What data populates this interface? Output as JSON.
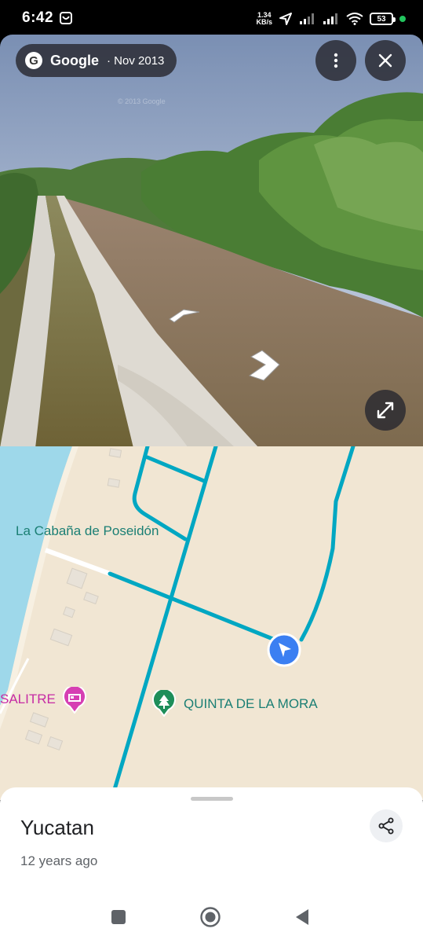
{
  "status_bar": {
    "time": "6:42",
    "net_speed_value": "1.34",
    "net_speed_unit": "KB/s",
    "battery": "53"
  },
  "street_view": {
    "brand": "Google",
    "date": "· Nov 2013",
    "watermark": "© 2013 Google"
  },
  "map": {
    "labels": {
      "cabana": "La Cabaña de Poseidón",
      "salitre": "SALITRE",
      "quinta": "QUINTA DE LA MORA"
    }
  },
  "sheet": {
    "title": "Yucatan",
    "subtitle": "12 years ago"
  },
  "colors": {
    "road": "#00a7c2",
    "water": "#9ed8ea",
    "land": "#f1e6d3",
    "location_marker": "#3b7ff2"
  },
  "icons": [
    "google-logo-icon",
    "more-vert-icon",
    "close-icon",
    "fullscreen-icon",
    "nav-arrow-icon",
    "hotel-icon",
    "park-icon",
    "location-arrow-icon",
    "share-icon",
    "recents-icon",
    "home-icon",
    "back-icon"
  ]
}
